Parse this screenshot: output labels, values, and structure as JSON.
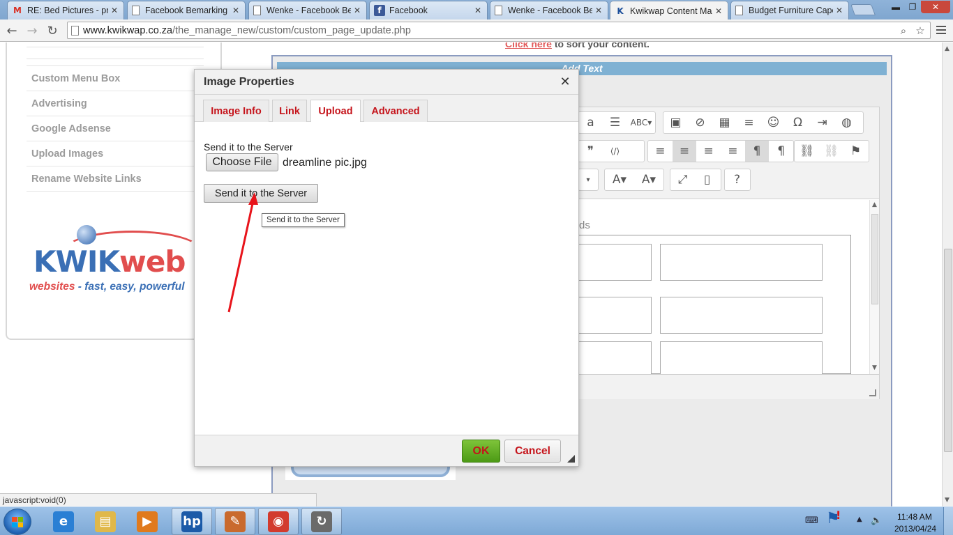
{
  "browser": {
    "tabs": [
      {
        "icon": "gmail-icon",
        "title": "RE: Bed Pictures - pret"
      },
      {
        "icon": "page-icon",
        "title": "Facebook Bemarking S"
      },
      {
        "icon": "page-icon",
        "title": "Wenke - Facebook Ber"
      },
      {
        "icon": "facebook-icon",
        "title": "Facebook"
      },
      {
        "icon": "page-icon",
        "title": "Wenke - Facebook Ber"
      },
      {
        "icon": "kwikwap-icon",
        "title": "Kwikwap Content Mar"
      },
      {
        "icon": "page-icon",
        "title": "Budget Furniture Cape"
      }
    ],
    "active_tab": 5,
    "close_glyph": "✕",
    "window_controls": {
      "minimize": "▬",
      "maximize": "❐",
      "close": "✕"
    },
    "nav": {
      "back": "←",
      "forward": "→",
      "reload": "↻"
    },
    "url_domain": "www.kwikwap.co.za",
    "url_path": "/the_manage_new/custom/custom_page_update.php",
    "zoom_glyph": "⌕",
    "star_glyph": "☆"
  },
  "sidebar": {
    "items": [
      "Custom Menu Box",
      "Advertising",
      "Google Adsense",
      "Upload Images",
      "Rename Website Links"
    ],
    "logo": {
      "word1": "KWIK",
      "word2": "web",
      "tagline_red": "websites",
      "tagline_rest": " - fast, easy, powerful"
    }
  },
  "content": {
    "sort_link": "Click here",
    "sort_text": " to sort your content.",
    "add_text_title": "Add Text",
    "editor_hint": "ds",
    "toolbar_rows": [
      [
        "a",
        "☰",
        "ABC▾",
        "▣",
        "⊘",
        "▦",
        "≡",
        "☺",
        "Ω",
        "⇥",
        "◍"
      ],
      [
        "❞",
        "⟨/⟩",
        "≡",
        "≡",
        "≡",
        "≡",
        "¶",
        "¶",
        "⛓",
        "⛓",
        "⚑"
      ],
      [
        "▾",
        "A▾",
        "A▾",
        "⤢",
        "▯",
        "?"
      ]
    ]
  },
  "dialog": {
    "title": "Image Properties",
    "close": "✕",
    "tabs": [
      "Image Info",
      "Link",
      "Upload",
      "Advanced"
    ],
    "active_tab": "Upload",
    "upload_label": "Send it to the Server",
    "choose_file": "Choose File",
    "file_name": "dreamline pic.jpg",
    "send_button": "Send it to the Server",
    "tooltip": "Send it to the Server",
    "ok": "OK",
    "cancel": "Cancel"
  },
  "status_bar": {
    "url": "javascript:void(0)"
  },
  "taskbar": {
    "apps": [
      {
        "name": "internet-explorer-icon",
        "glyph": "e",
        "color": "#2a7fd4"
      },
      {
        "name": "file-explorer-icon",
        "glyph": "▤",
        "color": "#e0b84a"
      },
      {
        "name": "media-player-icon",
        "glyph": "▶",
        "color": "#e07a1d"
      },
      {
        "name": "hp-icon",
        "glyph": "hp",
        "color": "#1b5aa8"
      },
      {
        "name": "paint-icon",
        "glyph": "✎",
        "color": "#c96a2e"
      },
      {
        "name": "chrome-icon",
        "glyph": "◉",
        "color": "#d23b2e"
      },
      {
        "name": "sync-icon",
        "glyph": "↻",
        "color": "#6a6a6a"
      }
    ],
    "clock_time": "11:48 AM",
    "clock_date": "2013/04/24"
  }
}
